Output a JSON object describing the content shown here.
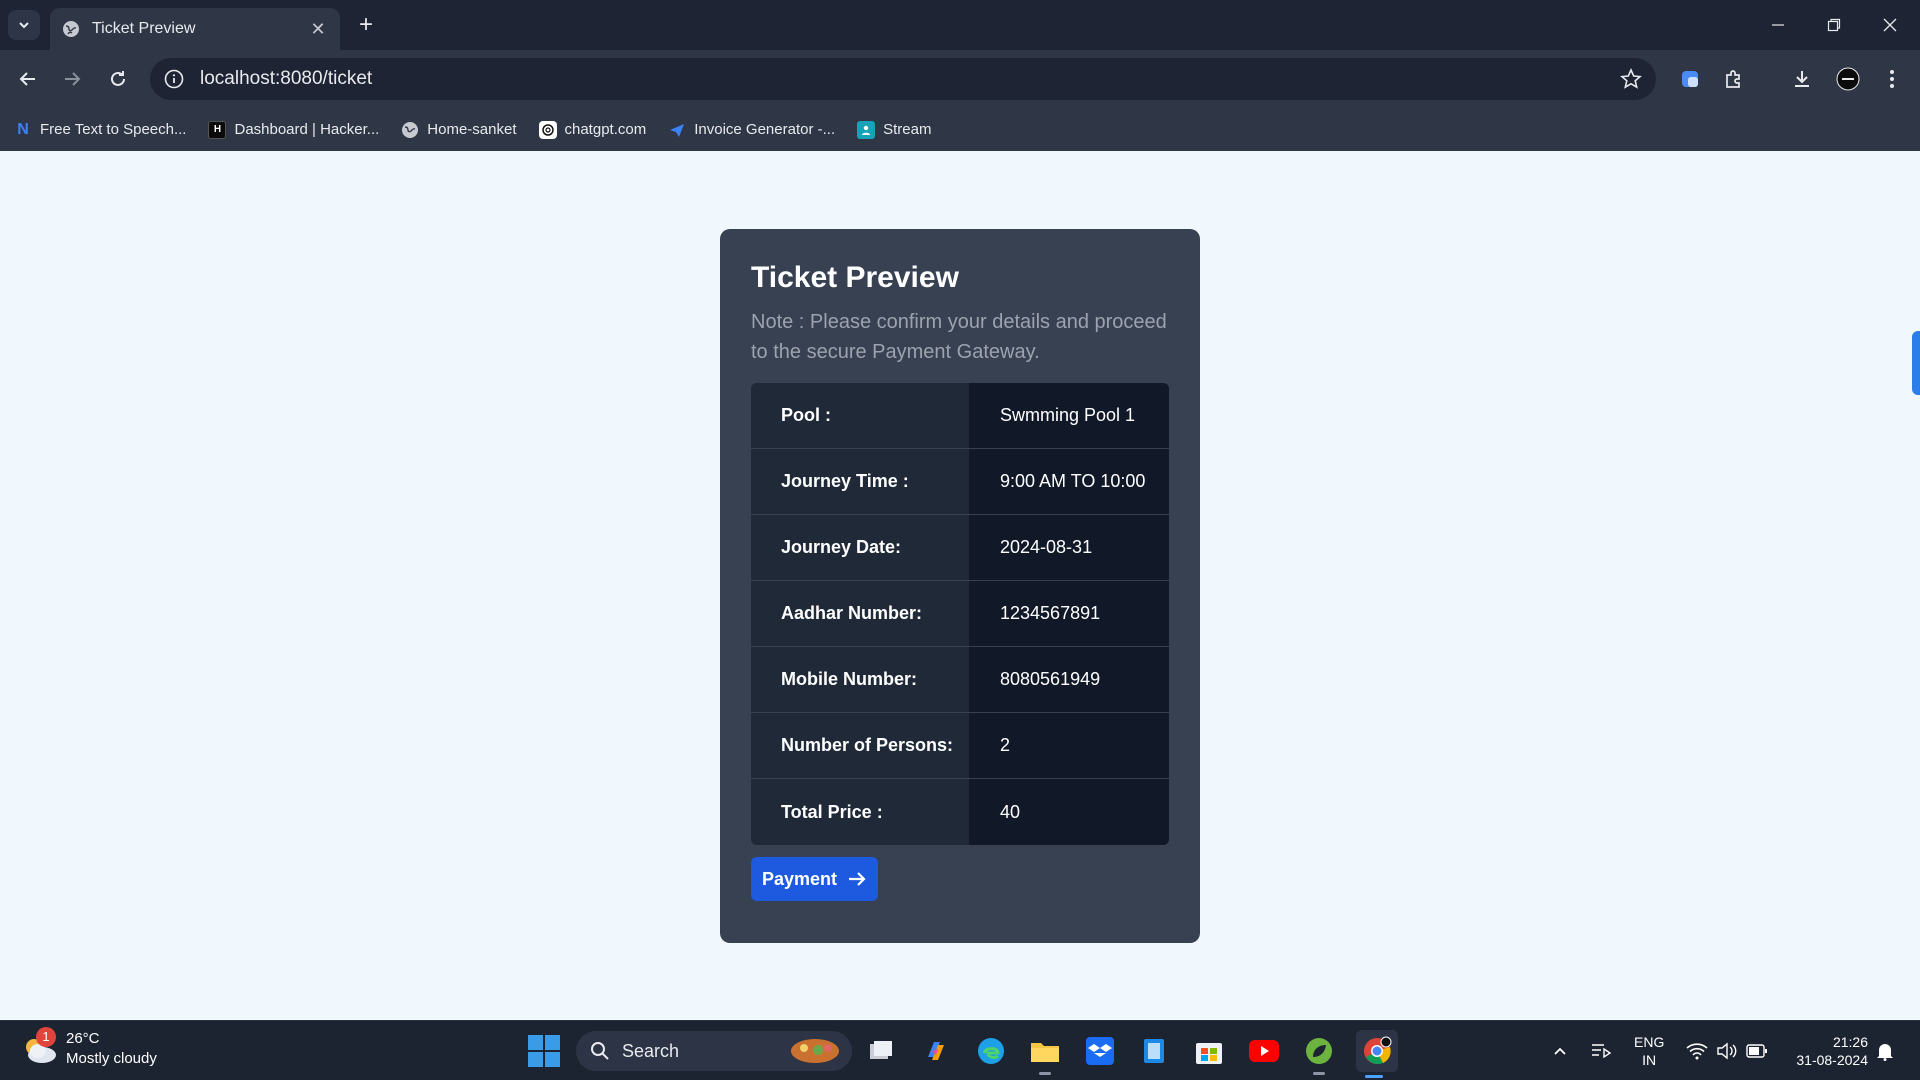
{
  "browser": {
    "tab_title": "Ticket Preview",
    "url": "localhost:8080/ticket",
    "bookmarks": [
      {
        "label": "Free Text to Speech...",
        "icon": "n-logo-icon"
      },
      {
        "label": "Dashboard | Hacker...",
        "icon": "hackerrank-icon"
      },
      {
        "label": "Home-sanket",
        "icon": "globe-icon"
      },
      {
        "label": "chatgpt.com",
        "icon": "chatgpt-icon"
      },
      {
        "label": "Invoice Generator -...",
        "icon": "paper-plane-icon"
      },
      {
        "label": "Stream",
        "icon": "stream-icon"
      }
    ]
  },
  "page": {
    "title": "Ticket Preview",
    "note": "Note : Please confirm your details and proceed to the secure Payment Gateway.",
    "rows": [
      {
        "label": "Pool :",
        "value": "Swmming Pool 1"
      },
      {
        "label": "Journey Time :",
        "value": "9:00 AM TO 10:00"
      },
      {
        "label": "Journey Date:",
        "value": "2024-08-31"
      },
      {
        "label": "Aadhar Number:",
        "value": "1234567891"
      },
      {
        "label": "Mobile Number:",
        "value": "8080561949"
      },
      {
        "label": "Number of Persons:",
        "value": "2"
      },
      {
        "label": "Total Price :",
        "value": "40"
      }
    ],
    "payment_button": "Payment"
  },
  "taskbar": {
    "weather_badge": "1",
    "temperature": "26°C",
    "weather_desc": "Mostly cloudy",
    "search_label": "Search",
    "lang_line1": "ENG",
    "lang_line2": "IN",
    "time": "21:26",
    "date": "31-08-2024"
  },
  "colors": {
    "card_bg": "#374152",
    "label_bg": "#1f2937",
    "value_bg": "#111827",
    "button": "#1d5ae0",
    "page_bg": "#f0f7fd"
  }
}
